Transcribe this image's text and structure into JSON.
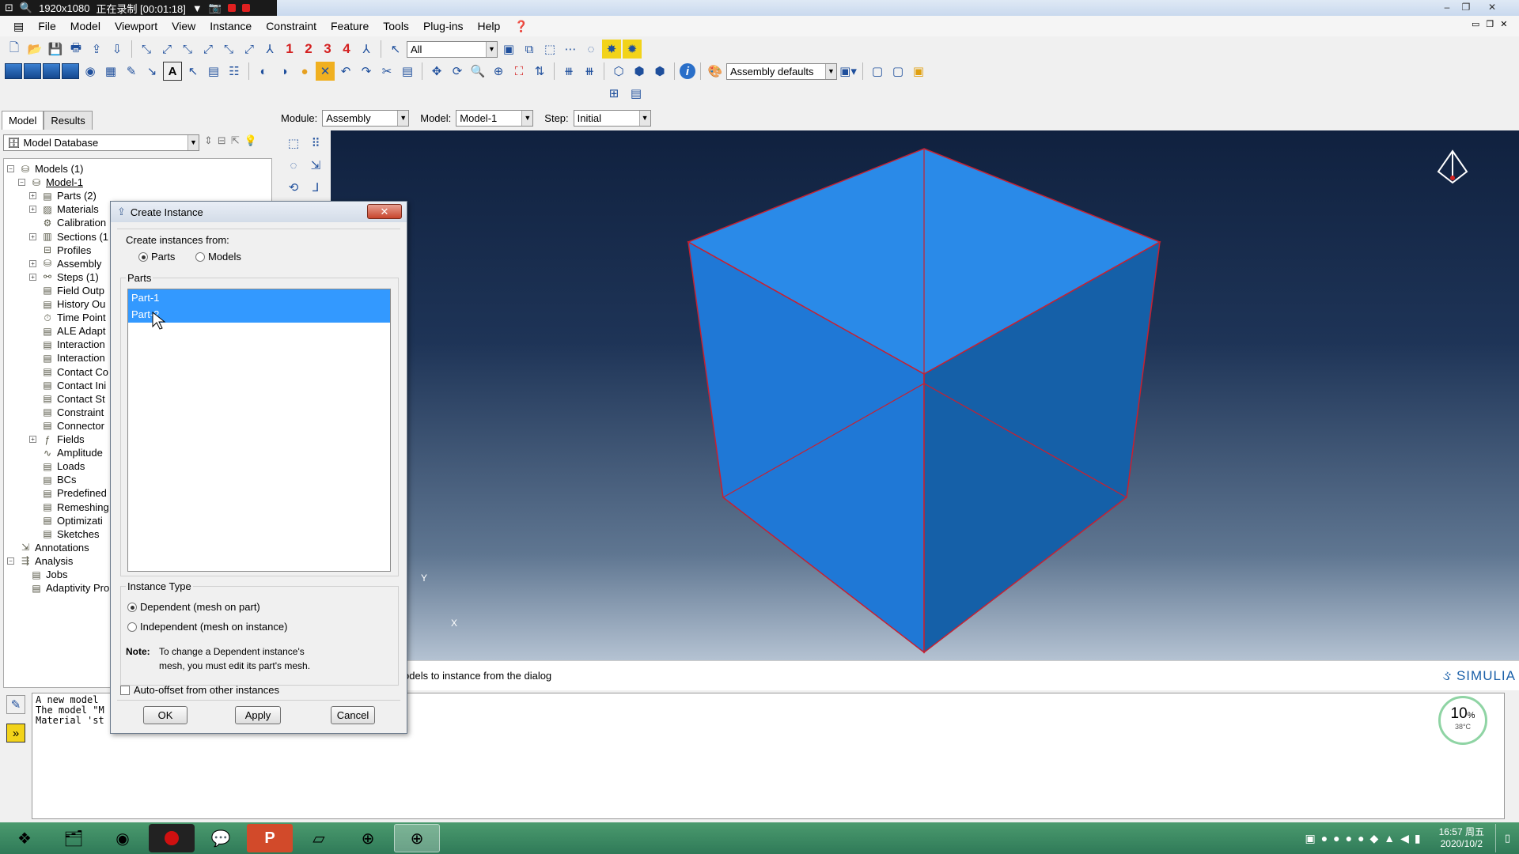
{
  "recorder": {
    "resolution": "1920x1080",
    "status": "正在录制 [00:01:18]"
  },
  "menu": [
    "File",
    "Model",
    "Viewport",
    "View",
    "Instance",
    "Constraint",
    "Feature",
    "Tools",
    "Plug-ins",
    "Help",
    "❓"
  ],
  "toolbar": {
    "selection_filter": "All",
    "render_style": "Assembly defaults",
    "numbers": [
      "1",
      "2",
      "3",
      "4"
    ]
  },
  "context": {
    "module_label": "Module:",
    "module_value": "Assembly",
    "model_label": "Model:",
    "model_value": "Model-1",
    "step_label": "Step:",
    "step_value": "Initial"
  },
  "left_panel": {
    "tabs": [
      "Model",
      "Results"
    ],
    "database": "Model Database",
    "tree": [
      {
        "label": "Models (1)",
        "level": 0,
        "exp": "-"
      },
      {
        "label": "Model-1",
        "level": 1,
        "exp": "-",
        "underline": true
      },
      {
        "label": "Parts (2)",
        "level": 2,
        "exp": "+"
      },
      {
        "label": "Materials",
        "level": 2,
        "exp": "+"
      },
      {
        "label": "Calibration",
        "level": 2,
        "exp": ""
      },
      {
        "label": "Sections (1",
        "level": 2,
        "exp": "+"
      },
      {
        "label": "Profiles",
        "level": 2,
        "exp": ""
      },
      {
        "label": "Assembly",
        "level": 2,
        "exp": "+"
      },
      {
        "label": "Steps (1)",
        "level": 2,
        "exp": "+"
      },
      {
        "label": "Field Outp",
        "level": 2,
        "exp": ""
      },
      {
        "label": "History Ou",
        "level": 2,
        "exp": ""
      },
      {
        "label": "Time Point",
        "level": 2,
        "exp": ""
      },
      {
        "label": "ALE Adapt",
        "level": 2,
        "exp": ""
      },
      {
        "label": "Interaction",
        "level": 2,
        "exp": ""
      },
      {
        "label": "Interaction",
        "level": 2,
        "exp": ""
      },
      {
        "label": "Contact Co",
        "level": 2,
        "exp": ""
      },
      {
        "label": "Contact Ini",
        "level": 2,
        "exp": ""
      },
      {
        "label": "Contact St",
        "level": 2,
        "exp": ""
      },
      {
        "label": "Constraint",
        "level": 2,
        "exp": ""
      },
      {
        "label": "Connector",
        "level": 2,
        "exp": ""
      },
      {
        "label": "Fields",
        "level": 2,
        "exp": "+"
      },
      {
        "label": "Amplitude",
        "level": 2,
        "exp": ""
      },
      {
        "label": "Loads",
        "level": 2,
        "exp": ""
      },
      {
        "label": "BCs",
        "level": 2,
        "exp": ""
      },
      {
        "label": "Predefined",
        "level": 2,
        "exp": ""
      },
      {
        "label": "Remeshing",
        "level": 2,
        "exp": ""
      },
      {
        "label": "Optimizati",
        "level": 2,
        "exp": ""
      },
      {
        "label": "Sketches",
        "level": 2,
        "exp": ""
      },
      {
        "label": "Annotations",
        "level": 0,
        "exp": ""
      },
      {
        "label": "Analysis",
        "level": 0,
        "exp": "-"
      },
      {
        "label": "Jobs",
        "level": 1,
        "exp": ""
      },
      {
        "label": "Adaptivity Pro",
        "level": 1,
        "exp": ""
      }
    ]
  },
  "dialog": {
    "title": "Create Instance",
    "create_from_label": "Create instances from:",
    "from_parts": "Parts",
    "from_models": "Models",
    "parts_group": "Parts",
    "parts": [
      "Part-1",
      "Part-2"
    ],
    "instance_type_group": "Instance Type",
    "dependent": "Dependent (mesh on part)",
    "independent": "Independent (mesh on instance)",
    "note_label": "Note:",
    "note_line1": "To change a Dependent instance's",
    "note_line2": "mesh, you must edit its part's mesh.",
    "auto_offset": "Auto-offset from other instances",
    "ok": "OK",
    "apply": "Apply",
    "cancel": "Cancel"
  },
  "prompt": "odels to instance from the dialog",
  "brand": "SIMULIA",
  "messages": "A new model\nThe model \"M\nMaterial 'st",
  "cpu": {
    "percent": "10",
    "unit": "%",
    "temp": "38°C"
  },
  "triad": {
    "x": "X",
    "y": "Y"
  },
  "clock": {
    "time": "16:57 周五",
    "date": "2020/10/2"
  },
  "colors": {
    "cube_light": "#2a8ae8",
    "cube_dark": "#1560a8",
    "edge": "#c82030",
    "selection": "#3399ff"
  }
}
